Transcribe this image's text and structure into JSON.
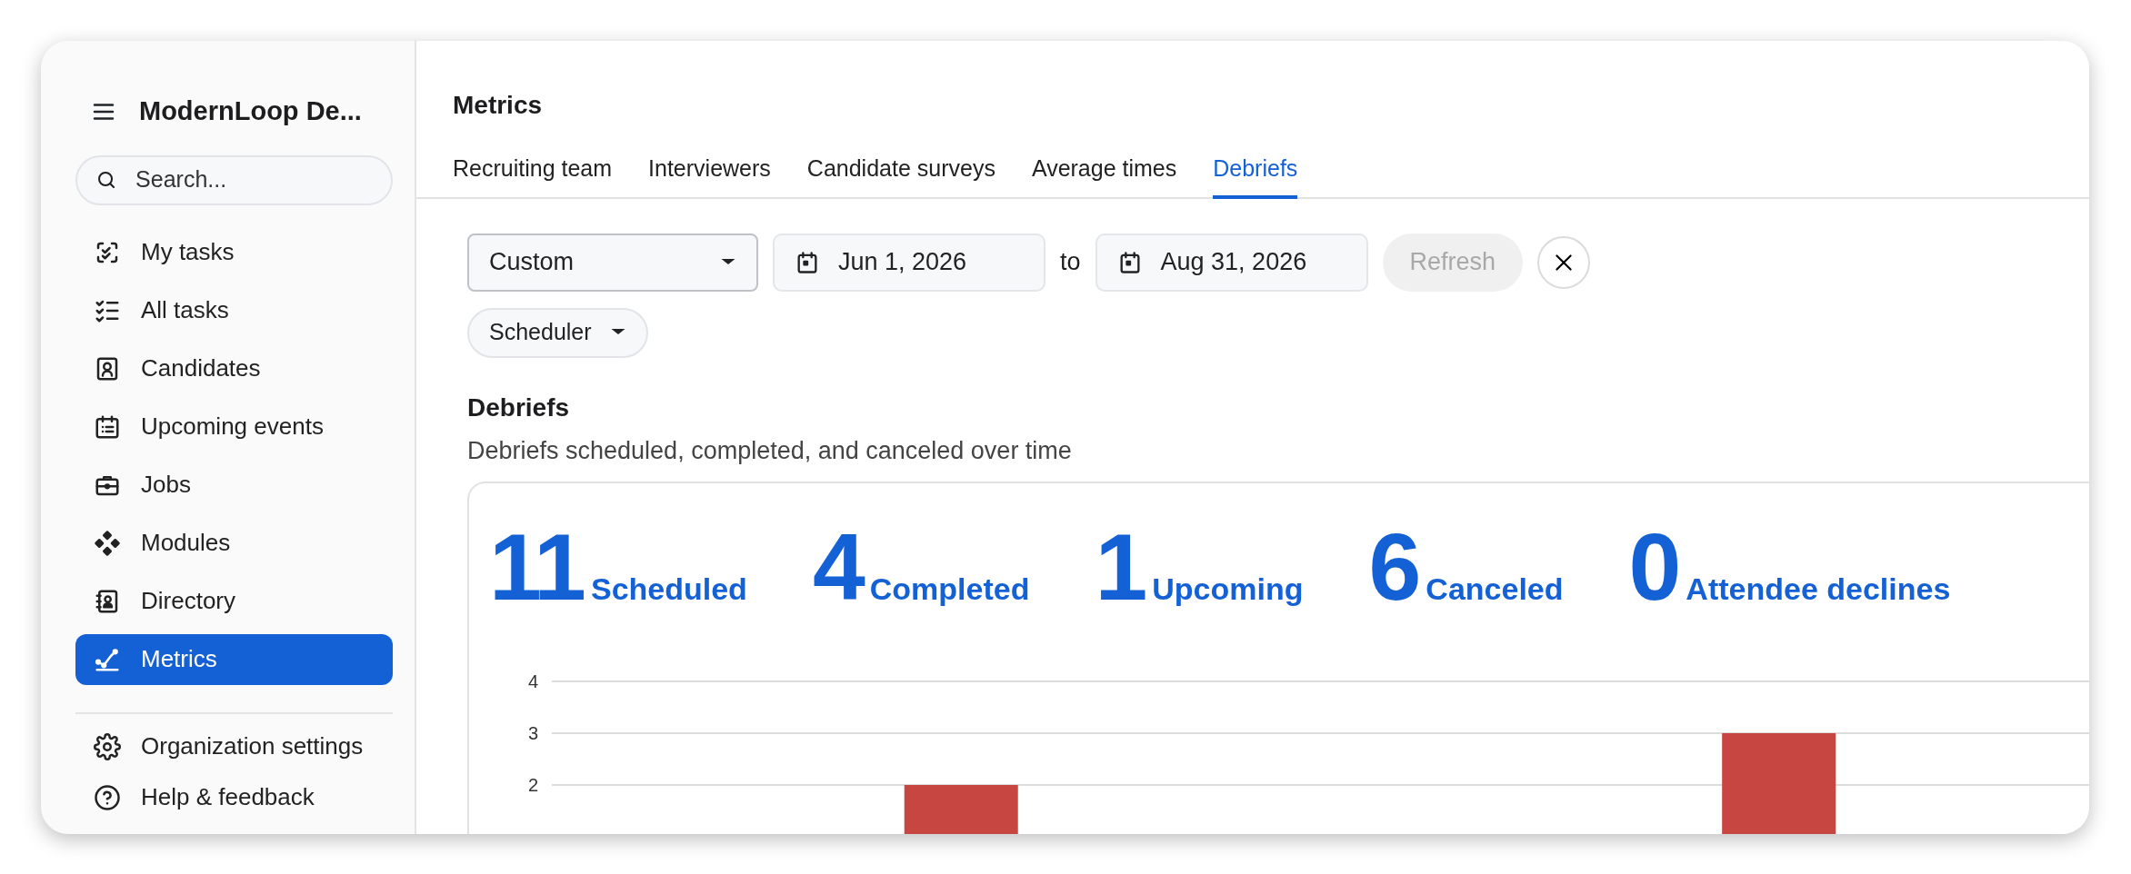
{
  "sidebar": {
    "title": "ModernLoop De...",
    "search": {
      "placeholder": "Search..."
    },
    "items": [
      {
        "label": "My tasks",
        "selected": false
      },
      {
        "label": "All tasks",
        "selected": false
      },
      {
        "label": "Candidates",
        "selected": false
      },
      {
        "label": "Upcoming events",
        "selected": false
      },
      {
        "label": "Jobs",
        "selected": false
      },
      {
        "label": "Modules",
        "selected": false
      },
      {
        "label": "Directory",
        "selected": false
      },
      {
        "label": "Metrics",
        "selected": true
      }
    ],
    "footer_items": [
      {
        "label": "Organization settings"
      },
      {
        "label": "Help & feedback"
      }
    ]
  },
  "header": {
    "title": "Metrics",
    "tabs": [
      {
        "label": "Recruiting team",
        "selected": false
      },
      {
        "label": "Interviewers",
        "selected": false
      },
      {
        "label": "Candidate surveys",
        "selected": false
      },
      {
        "label": "Average times",
        "selected": false
      },
      {
        "label": "Debriefs",
        "selected": true
      }
    ]
  },
  "filters": {
    "range": "Custom",
    "start_date": "Jun 1, 2026",
    "separator": "to",
    "end_date": "Aug 31, 2026",
    "refresh": {
      "label": "Refresh",
      "disabled": true
    },
    "role": "Scheduler"
  },
  "section": {
    "title": "Debriefs",
    "subtitle": "Debriefs scheduled, completed, and canceled over time",
    "stats": [
      {
        "value": "11",
        "label": "Scheduled"
      },
      {
        "value": "4",
        "label": "Completed"
      },
      {
        "value": "1",
        "label": "Upcoming"
      },
      {
        "value": "6",
        "label": "Canceled"
      },
      {
        "value": "0",
        "label": "Attendee declines"
      }
    ],
    "chart_data": {
      "type": "bar",
      "yticks": [
        2,
        3,
        4
      ],
      "ylim": [
        0,
        4
      ],
      "series": [
        {
          "color": "#c84641",
          "values": [
            null,
            null,
            2,
            null,
            null,
            null,
            null,
            3,
            null
          ]
        }
      ]
    }
  }
}
